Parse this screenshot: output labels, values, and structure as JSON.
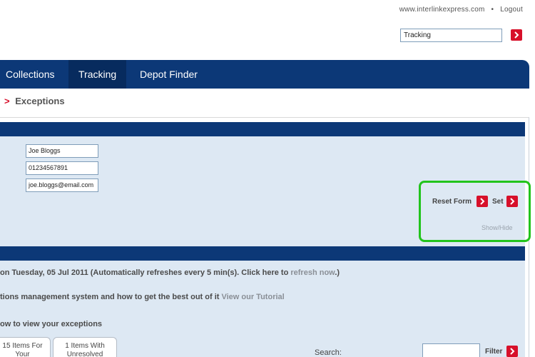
{
  "header": {
    "site_link": "www.interlinkexpress.com",
    "separator": "•",
    "logout": "Logout",
    "search_value": "Tracking"
  },
  "nav": {
    "items": [
      {
        "label": "Collections"
      },
      {
        "label": "Tracking"
      },
      {
        "label": "Depot Finder"
      }
    ]
  },
  "breadcrumb": {
    "arrow": ">",
    "current": "Exceptions"
  },
  "form": {
    "name_value": "Joe Bloggs",
    "phone_value": "01234567891",
    "email_value": "joe.bloggs@email.com",
    "reset_label": "Reset Form",
    "set_label": "Set",
    "showhide_label": "Show/Hide"
  },
  "info": {
    "refresh_text": "on Tuesday, 05 Jul 2011 (Automatically refreshes every 5 min(s). Click here to ",
    "refresh_link": "refresh now",
    "refresh_tail": ".)",
    "tutorial_text": "tions management system and how to get the best out of it ",
    "tutorial_link": "View our Tutorial",
    "view_text": "ow to view your exceptions"
  },
  "tabs": [
    {
      "label": "15 Items For Your"
    },
    {
      "label": "1 Items With Unresolved"
    }
  ],
  "filter": {
    "search_label": "Search:",
    "filter_label": "Filter"
  },
  "colors": {
    "brand_blue": "#0c3877",
    "accent_red": "#d7102a",
    "panel_bg": "#dde8f3",
    "highlight_green": "#22c41c"
  }
}
